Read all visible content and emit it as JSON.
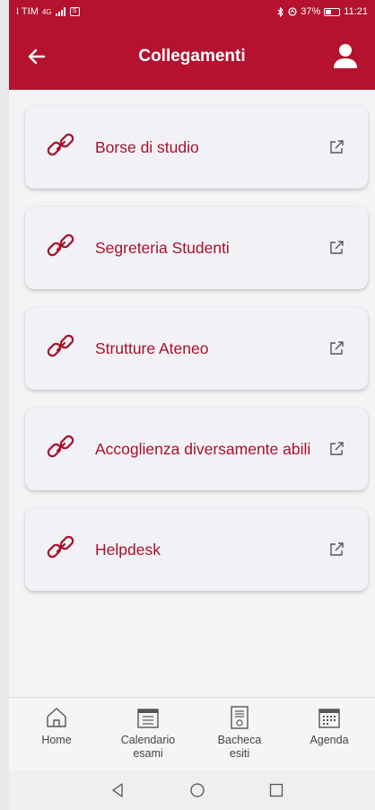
{
  "status_bar": {
    "carrier": "I TIM",
    "network": "4G",
    "battery": "37%",
    "time": "11:21"
  },
  "app_bar": {
    "title": "Collegamenti"
  },
  "links": [
    {
      "label": "Borse di studio"
    },
    {
      "label": "Segreteria Studenti"
    },
    {
      "label": "Strutture Ateneo"
    },
    {
      "label": "Accoglienza diversamente abili"
    },
    {
      "label": "Helpdesk"
    }
  ],
  "bottom_nav": [
    {
      "label": "Home",
      "icon": "home-icon"
    },
    {
      "label": "Calendario esami",
      "icon": "calendar-list-icon"
    },
    {
      "label": "Bacheca esiti",
      "icon": "noticeboard-icon"
    },
    {
      "label": "Agenda",
      "icon": "agenda-icon"
    }
  ],
  "colors": {
    "brand": "#b5122f",
    "link_text": "#a8102b",
    "card_bg": "#f2f2f6"
  }
}
